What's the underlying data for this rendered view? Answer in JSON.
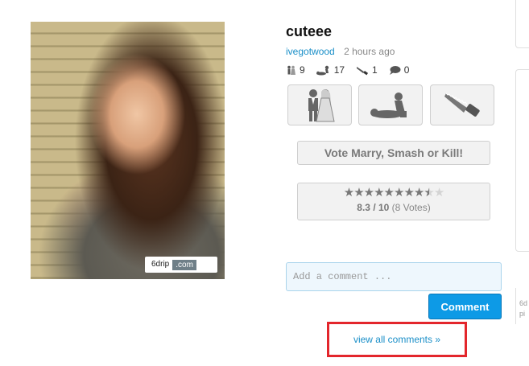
{
  "post": {
    "title": "cuteee",
    "author": "ivegotwood",
    "time_ago": "2 hours ago"
  },
  "watermark": {
    "name": "6drip",
    "domain": ".com"
  },
  "counts": {
    "marry": "9",
    "smash": "17",
    "kill": "1",
    "comments": "0"
  },
  "buttons": {
    "marry_icon": "marry-couple-icon",
    "smash_icon": "smash-icon",
    "kill_icon": "knife-icon",
    "vote_label": "Vote Marry, Smash or Kill!"
  },
  "rating": {
    "score": "8.3",
    "out_of": "/ 10",
    "votes": "(8 Votes)",
    "value": 8.3,
    "max": 10
  },
  "comment": {
    "placeholder": "Add a comment ...",
    "submit_label": "Comment",
    "view_all_label": "view all comments »"
  },
  "sidebar": {
    "snippet_line1": "6d",
    "snippet_line2": "pi"
  },
  "colors": {
    "accent": "#0d9ae6",
    "link": "#1a8fc8",
    "highlight": "#e3262c"
  }
}
